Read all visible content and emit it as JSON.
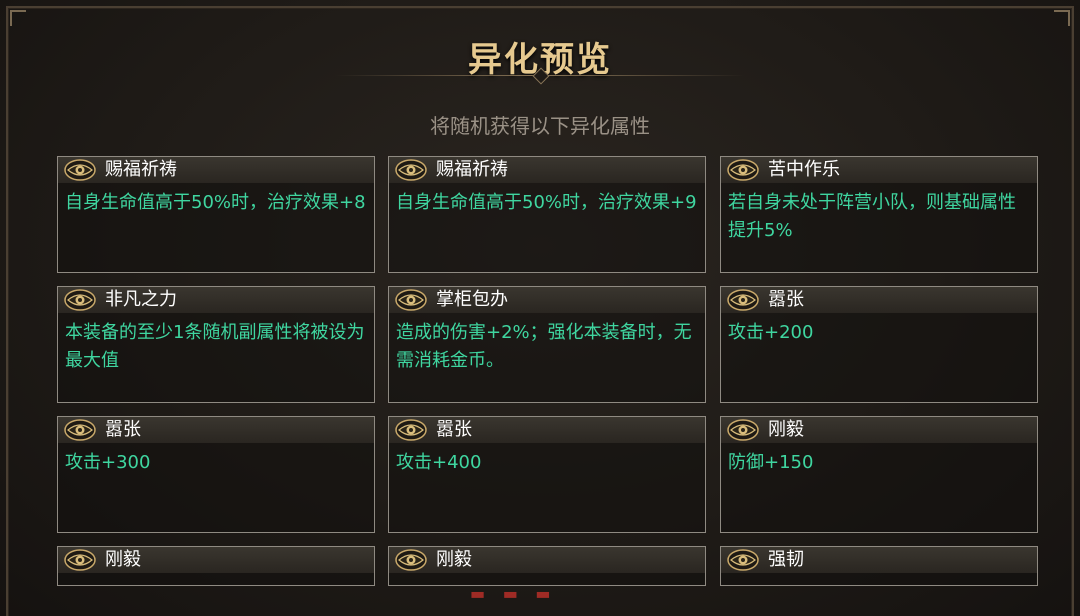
{
  "title": "异化预览",
  "subtitle": "将随机获得以下异化属性",
  "cards": [
    {
      "name": "赐福祈祷",
      "desc": "自身生命值高于50%时，治疗效果+8"
    },
    {
      "name": "赐福祈祷",
      "desc": "自身生命值高于50%时，治疗效果+9"
    },
    {
      "name": "苦中作乐",
      "desc": "若自身未处于阵营小队，则基础属性提升5%"
    },
    {
      "name": "非凡之力",
      "desc": "本装备的至少1条随机副属性将被设为最大值"
    },
    {
      "name": "掌柜包办",
      "desc": "造成的伤害+2%；强化本装备时，无需消耗金币。"
    },
    {
      "name": "嚣张",
      "desc": "攻击+200"
    },
    {
      "name": "嚣张",
      "desc": "攻击+300"
    },
    {
      "name": "嚣张",
      "desc": "攻击+400"
    },
    {
      "name": "刚毅",
      "desc": "防御+150"
    },
    {
      "name": "刚毅",
      "desc": ""
    },
    {
      "name": "刚毅",
      "desc": ""
    },
    {
      "name": "强韧",
      "desc": ""
    }
  ],
  "colors": {
    "title": "#e6c98f",
    "desc": "#3fd6a0",
    "name": "#ffffff",
    "card_border": "#8f8a82"
  },
  "icon": "eye-icon"
}
